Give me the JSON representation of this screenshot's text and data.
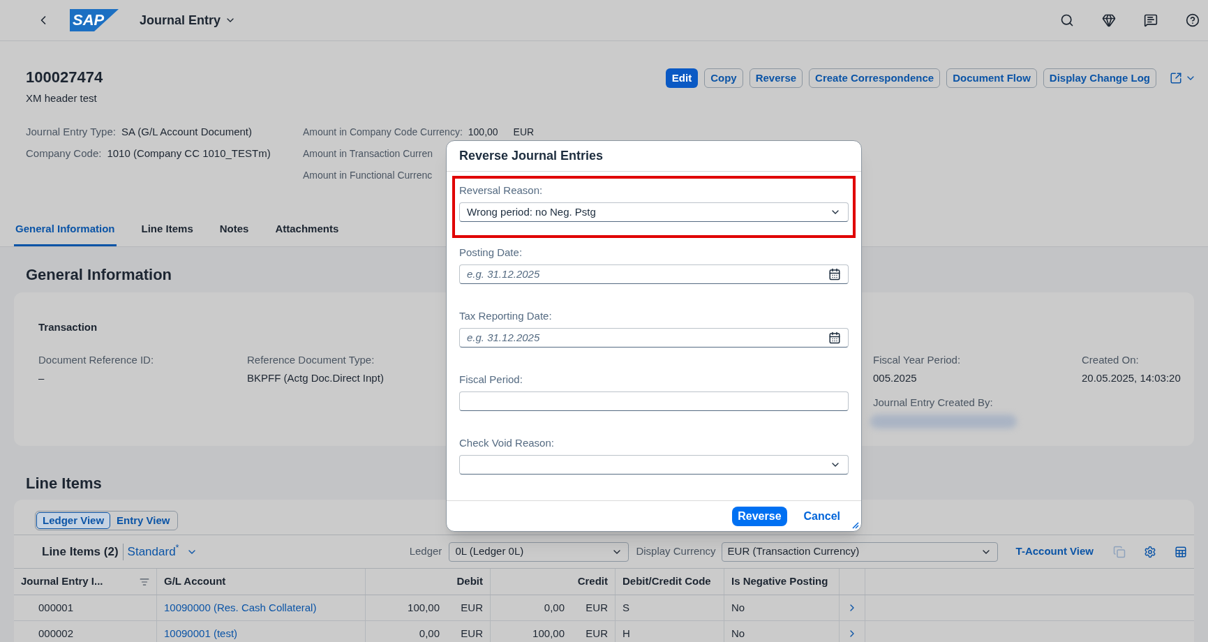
{
  "shell": {
    "logo": "SAP",
    "title": "Journal Entry"
  },
  "header": {
    "title": "100027474",
    "subtitle": "XM header test",
    "actions": [
      {
        "label": "Edit",
        "kind": "primary"
      },
      {
        "label": "Copy",
        "kind": "default"
      },
      {
        "label": "Reverse",
        "kind": "default"
      },
      {
        "label": "Create Correspondence",
        "kind": "default"
      },
      {
        "label": "Document Flow",
        "kind": "default"
      },
      {
        "label": "Display Change Log",
        "kind": "default"
      }
    ],
    "attributes_left": [
      {
        "label": "Journal Entry Type:",
        "value": "SA (G/L Account Document)"
      },
      {
        "label": "Company Code:",
        "value": "1010 (Company CC 1010_TESTm)"
      }
    ],
    "attributes_right": [
      {
        "label": "Amount in Company Code Currency:",
        "value": "100,00",
        "unit": "EUR"
      },
      {
        "label": "Amount in Transaction Curren"
      },
      {
        "label": "Amount in Functional Currenc"
      }
    ]
  },
  "tabs": [
    {
      "label": "General Information",
      "selected": true
    },
    {
      "label": "Line Items",
      "selected": false
    },
    {
      "label": "Notes",
      "selected": false
    },
    {
      "label": "Attachments",
      "selected": false
    }
  ],
  "general_information": {
    "title": "General Information",
    "group_title": "Transaction",
    "fields": [
      {
        "label": "Document Reference ID:",
        "value": "–"
      },
      {
        "label": "Reference Document Type:",
        "value": "BKPFF (Actg Doc.Direct Inpt)"
      }
    ],
    "fields_right": [
      {
        "label": "Fiscal Year Period:",
        "value": "005.2025"
      },
      {
        "label": "Created On:",
        "value": "20.05.2025, 14:03:20"
      }
    ],
    "created_by": {
      "label": "Journal Entry Created By:",
      "redacted": true
    }
  },
  "line_items": {
    "title": "Line Items",
    "views": [
      {
        "label": "Ledger View",
        "selected": true
      },
      {
        "label": "Entry View",
        "selected": false
      }
    ],
    "toolbar": {
      "title": "Line Items (2)",
      "variant": "Standard$^{*}$",
      "ledger_label": "Ledger",
      "ledger_value": "0L (Ledger 0L)",
      "currency_label": "Display Currency",
      "currency_value": "EUR (Transaction Currency)",
      "link": "T-Account View"
    },
    "columns": [
      "Journal Entry I...",
      "G/L Account",
      "",
      "Debit",
      "",
      "Credit",
      "Debit/Credit Code",
      "Is Negative Posting"
    ],
    "rows": [
      {
        "cells": [
          "000001",
          "10090000 (Res. Cash Collateral)",
          "100,00",
          "EUR",
          "0,00",
          "EUR",
          "S",
          "No"
        ]
      },
      {
        "cells": [
          "000002",
          "10090001 (test)",
          "0,00",
          "EUR",
          "100,00",
          "EUR",
          "H",
          "No"
        ]
      }
    ]
  },
  "dialog": {
    "title": "Reverse Journal Entries",
    "fields": [
      {
        "label": "Reversal Reason:",
        "kind": "select",
        "value": "Wrong period: no Neg. Pstg",
        "highlighted": true
      },
      {
        "label": "Posting Date:",
        "kind": "date",
        "placeholder": "e.g. 31.12.2025",
        "highlighted": false
      },
      {
        "label": "Tax Reporting Date:",
        "kind": "date",
        "placeholder": "e.g. 31.12.2025",
        "highlighted": false
      },
      {
        "label": "Fiscal Period:",
        "kind": "text",
        "highlighted": false
      },
      {
        "label": "Check Void Reason:",
        "kind": "select",
        "highlighted": false
      }
    ],
    "buttons": [
      {
        "label": "Reverse",
        "kind": "primary"
      },
      {
        "label": "Cancel",
        "kind": "transparent"
      }
    ]
  }
}
